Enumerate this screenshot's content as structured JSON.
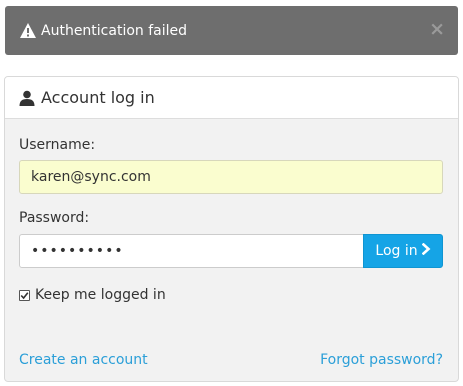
{
  "alert": {
    "message": "Authentication failed",
    "close_glyph": "×",
    "icon": "warning-icon"
  },
  "panel": {
    "title": "Account log in",
    "icon": "user-icon"
  },
  "form": {
    "username_label": "Username:",
    "username_value": "karen@sync.com",
    "password_label": "Password:",
    "password_value": "••••••••••",
    "login_label": "Log in",
    "login_icon": "chevron-right-icon",
    "remember_label": "Keep me logged in",
    "remember_checked": true
  },
  "links": {
    "create_account": "Create an account",
    "forgot_password": "Forgot password?"
  },
  "colors": {
    "alert_bg": "#6e6e6e",
    "accent": "#15a4e6",
    "link": "#2b9fd8",
    "autofill_bg": "#fafdcf"
  }
}
